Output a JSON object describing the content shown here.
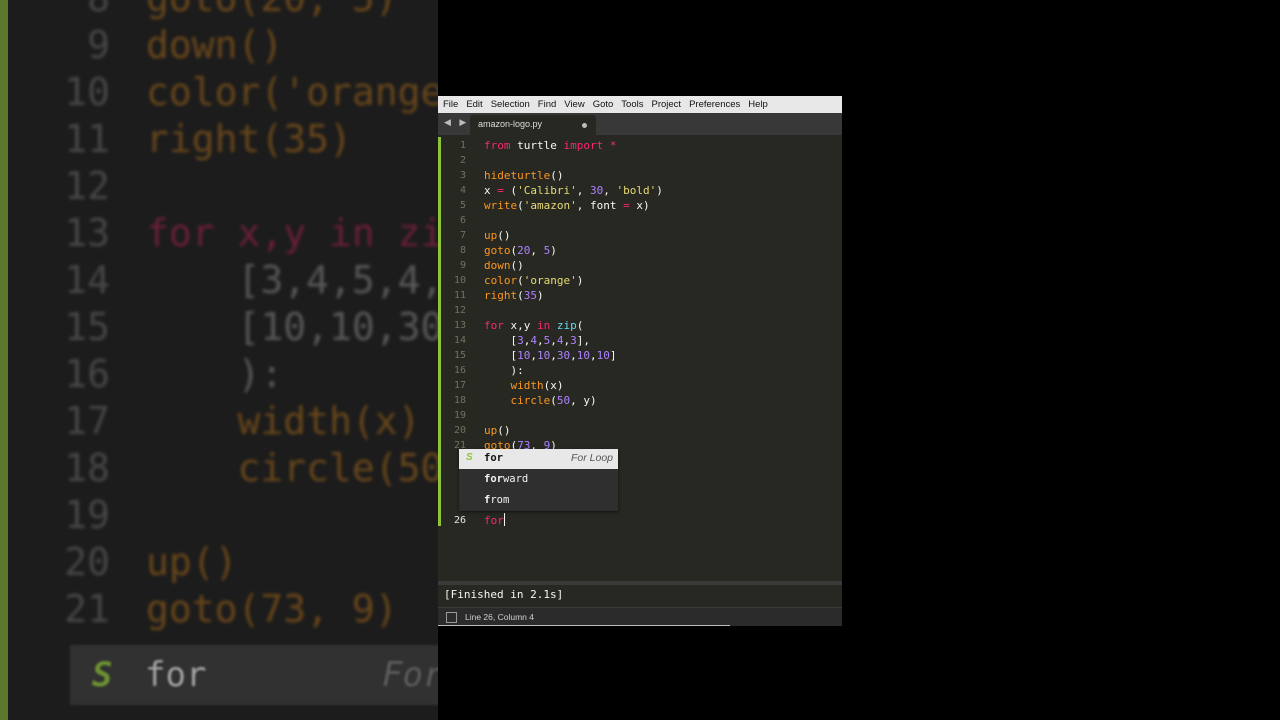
{
  "background": {
    "lines": [
      {
        "n": "8",
        "text": "goto(20, 5)"
      },
      {
        "n": "9",
        "text": "down()"
      },
      {
        "n": "10",
        "text": "color('orange"
      },
      {
        "n": "11",
        "text": "right(35)"
      },
      {
        "n": "12",
        "text": ""
      },
      {
        "n": "13",
        "text": "for x,y in zi"
      },
      {
        "n": "14",
        "text": "    [3,4,5,4,"
      },
      {
        "n": "15",
        "text": "    [10,10,30"
      },
      {
        "n": "16",
        "text": "    ):"
      },
      {
        "n": "17",
        "text": "    width(x)"
      },
      {
        "n": "18",
        "text": "    circle(50"
      },
      {
        "n": "19",
        "text": ""
      },
      {
        "n": "20",
        "text": "up()"
      },
      {
        "n": "21",
        "text": "goto(73, 9)"
      }
    ],
    "autocomplete_word": "for",
    "autocomplete_hint": "For"
  },
  "menubar": {
    "items": [
      "File",
      "Edit",
      "Selection",
      "Find",
      "View",
      "Goto",
      "Tools",
      "Project",
      "Preferences",
      "Help"
    ]
  },
  "tabs": {
    "nav_arrows": "◀ ▶",
    "active": {
      "filename": "amazon-logo.py",
      "dirty_icon": "dot-icon"
    }
  },
  "editor": {
    "lines": [
      {
        "n": "1",
        "tokens": [
          [
            "kw",
            "from"
          ],
          [
            "pl",
            " turtle "
          ],
          [
            "kw",
            "import"
          ],
          [
            "pl",
            " "
          ],
          [
            "kw",
            "*"
          ]
        ]
      },
      {
        "n": "2",
        "tokens": []
      },
      {
        "n": "3",
        "tokens": [
          [
            "fo",
            "hideturtle"
          ],
          [
            "pl",
            "()"
          ]
        ]
      },
      {
        "n": "4",
        "tokens": [
          [
            "pl",
            "x "
          ],
          [
            "kw",
            "="
          ],
          [
            "pl",
            " ("
          ],
          [
            "st",
            "'Calibri'"
          ],
          [
            "pl",
            ", "
          ],
          [
            "nu",
            "30"
          ],
          [
            "pl",
            ", "
          ],
          [
            "st",
            "'bold'"
          ],
          [
            "pl",
            ")"
          ]
        ]
      },
      {
        "n": "5",
        "tokens": [
          [
            "fo",
            "write"
          ],
          [
            "pl",
            "("
          ],
          [
            "st",
            "'amazon'"
          ],
          [
            "pl",
            ", font "
          ],
          [
            "kw",
            "="
          ],
          [
            "pl",
            " x)"
          ]
        ]
      },
      {
        "n": "6",
        "tokens": []
      },
      {
        "n": "7",
        "tokens": [
          [
            "fo",
            "up"
          ],
          [
            "pl",
            "()"
          ]
        ]
      },
      {
        "n": "8",
        "tokens": [
          [
            "fo",
            "goto"
          ],
          [
            "pl",
            "("
          ],
          [
            "nu",
            "20"
          ],
          [
            "pl",
            ", "
          ],
          [
            "nu",
            "5"
          ],
          [
            "pl",
            ")"
          ]
        ]
      },
      {
        "n": "9",
        "tokens": [
          [
            "fo",
            "down"
          ],
          [
            "pl",
            "()"
          ]
        ]
      },
      {
        "n": "10",
        "tokens": [
          [
            "fo",
            "color"
          ],
          [
            "pl",
            "("
          ],
          [
            "st",
            "'orange'"
          ],
          [
            "pl",
            ")"
          ]
        ]
      },
      {
        "n": "11",
        "tokens": [
          [
            "fo",
            "right"
          ],
          [
            "pl",
            "("
          ],
          [
            "nu",
            "35"
          ],
          [
            "pl",
            ")"
          ]
        ]
      },
      {
        "n": "12",
        "tokens": []
      },
      {
        "n": "13",
        "tokens": [
          [
            "kw",
            "for"
          ],
          [
            "pl",
            " x,y "
          ],
          [
            "kw",
            "in"
          ],
          [
            "pl",
            " "
          ],
          [
            "bi",
            "zip"
          ],
          [
            "pl",
            "("
          ]
        ]
      },
      {
        "n": "14",
        "tokens": [
          [
            "pl",
            "    ["
          ],
          [
            "nu",
            "3"
          ],
          [
            "pl",
            ","
          ],
          [
            "nu",
            "4"
          ],
          [
            "pl",
            ","
          ],
          [
            "nu",
            "5"
          ],
          [
            "pl",
            ","
          ],
          [
            "nu",
            "4"
          ],
          [
            "pl",
            ","
          ],
          [
            "nu",
            "3"
          ],
          [
            "pl",
            "],"
          ]
        ]
      },
      {
        "n": "15",
        "tokens": [
          [
            "pl",
            "    ["
          ],
          [
            "nu",
            "10"
          ],
          [
            "pl",
            ","
          ],
          [
            "nu",
            "10"
          ],
          [
            "pl",
            ","
          ],
          [
            "nu",
            "30"
          ],
          [
            "pl",
            ","
          ],
          [
            "nu",
            "10"
          ],
          [
            "pl",
            ","
          ],
          [
            "nu",
            "10"
          ],
          [
            "pl",
            "]"
          ]
        ]
      },
      {
        "n": "16",
        "tokens": [
          [
            "pl",
            "    ):"
          ]
        ]
      },
      {
        "n": "17",
        "tokens": [
          [
            "pl",
            "    "
          ],
          [
            "fo",
            "width"
          ],
          [
            "pl",
            "(x)"
          ]
        ]
      },
      {
        "n": "18",
        "tokens": [
          [
            "pl",
            "    "
          ],
          [
            "fo",
            "circle"
          ],
          [
            "pl",
            "("
          ],
          [
            "nu",
            "50"
          ],
          [
            "pl",
            ", y)"
          ]
        ]
      },
      {
        "n": "19",
        "tokens": []
      },
      {
        "n": "20",
        "tokens": [
          [
            "fo",
            "up"
          ],
          [
            "pl",
            "()"
          ]
        ]
      },
      {
        "n": "21",
        "tokens": [
          [
            "fo",
            "goto"
          ],
          [
            "pl",
            "("
          ],
          [
            "nu",
            "73"
          ],
          [
            "pl",
            ", "
          ],
          [
            "nu",
            "9"
          ],
          [
            "pl",
            ")"
          ]
        ]
      },
      {
        "n": "2",
        "tokens": []
      },
      {
        "n": "2",
        "tokens": []
      },
      {
        "n": "2",
        "tokens": []
      },
      {
        "n": "2",
        "tokens": []
      },
      {
        "n": "26",
        "current": true,
        "tokens": [
          [
            "kw",
            "for"
          ]
        ]
      }
    ]
  },
  "autocomplete": {
    "items": [
      {
        "kind": "S",
        "match": "for",
        "rest": "",
        "hint": "For Loop",
        "selected": true
      },
      {
        "kind": "",
        "match": "for",
        "rest": "ward",
        "hint": "",
        "selected": false
      },
      {
        "kind": "",
        "match": "f",
        "rest": "rom",
        "hint": "",
        "selected": false
      }
    ]
  },
  "output": {
    "text": "[Finished in 2.1s]"
  },
  "status": {
    "position": "Line 26, Column 4"
  }
}
